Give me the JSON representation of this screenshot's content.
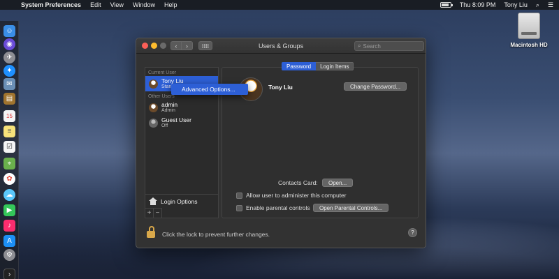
{
  "menubar": {
    "app": "System Preferences",
    "items": [
      "Edit",
      "View",
      "Window",
      "Help"
    ],
    "clock": "Thu 8:09 PM",
    "user": "Tony Liu",
    "battery_level": 0.85
  },
  "desktop": {
    "drive_label": "Macintosh HD"
  },
  "window": {
    "title": "Users & Groups",
    "search_placeholder": "Search",
    "back_glyph": "‹",
    "forward_glyph": "›"
  },
  "sidebar": {
    "current_user_header": "Current User",
    "other_users_header": "Other Users",
    "current_user": {
      "name": "Tony Liu",
      "role": "Standard"
    },
    "other_users": [
      {
        "name": "admin",
        "role": "Admin"
      },
      {
        "name": "Guest User",
        "role": "Off"
      }
    ],
    "login_options": "Login Options",
    "add_label": "+",
    "remove_label": "−"
  },
  "context_menu": {
    "item": "Advanced Options..."
  },
  "tabs": [
    "Password",
    "Login Items"
  ],
  "panel": {
    "user_name": "Tony Liu",
    "change_password": "Change Password...",
    "contacts_card_label": "Contacts Card:",
    "open_button": "Open...",
    "allow_admin": "Allow user to administer this computer",
    "parental_controls": "Enable parental controls",
    "open_parental": "Open Parental Controls..."
  },
  "footer": {
    "lock_text": "Click the lock to prevent further changes.",
    "help": "?"
  },
  "colors": {
    "accent": "#2d5fd6",
    "close": "#fc5f57",
    "minimize": "#fdbc2e"
  }
}
